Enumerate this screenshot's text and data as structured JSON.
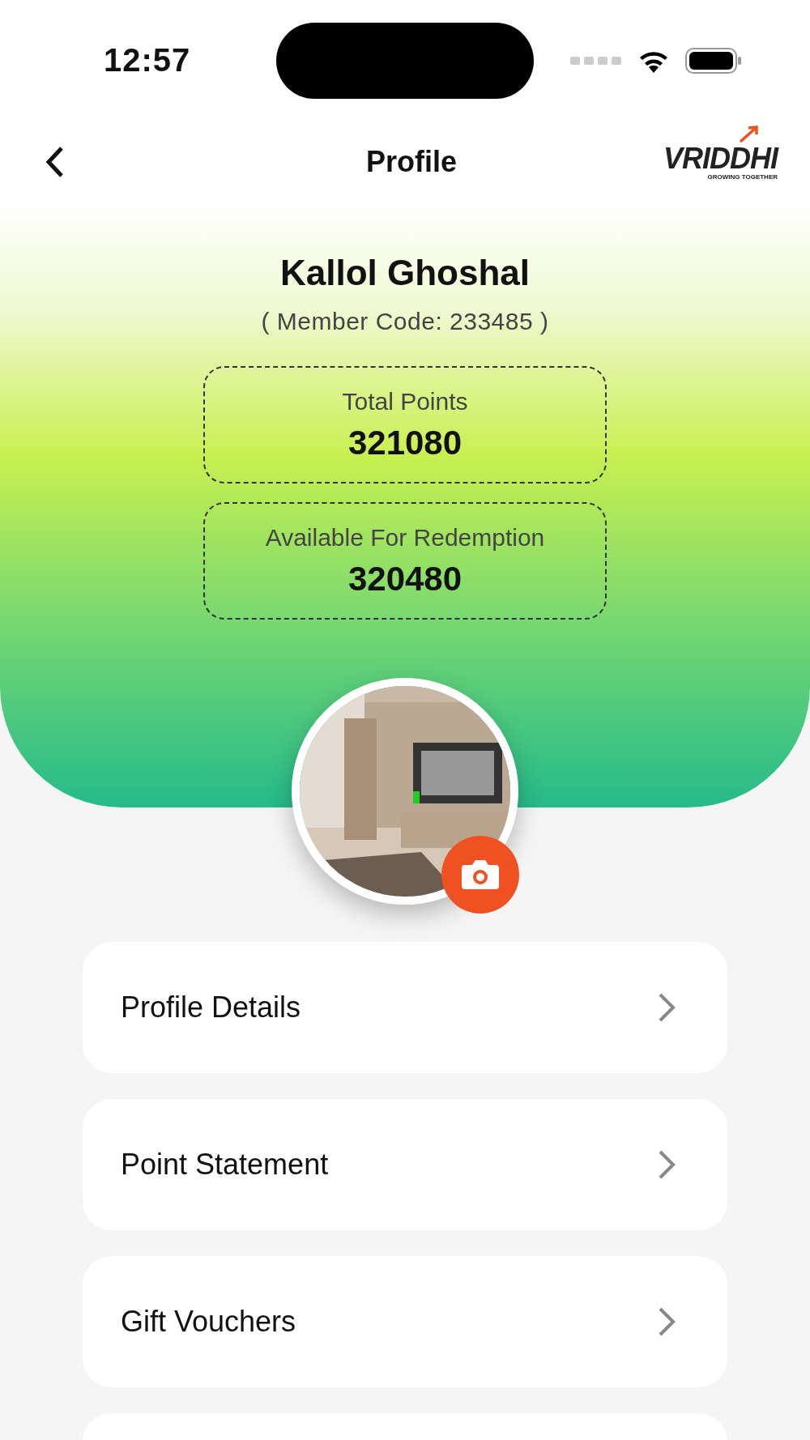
{
  "status_bar": {
    "time": "12:57"
  },
  "header": {
    "title": "Profile",
    "logo": {
      "name": "VRIDDHI",
      "tagline": "GROWING TOGETHER"
    }
  },
  "profile": {
    "name": "Kallol Ghoshal",
    "member_code": "( Member Code: 233485 )"
  },
  "points": [
    {
      "label": "Total Points",
      "value": "321080"
    },
    {
      "label": "Available For Redemption",
      "value": "320480"
    }
  ],
  "menu": [
    {
      "kind": "link",
      "label": "Profile Details"
    },
    {
      "kind": "link",
      "label": "Point Statement"
    },
    {
      "kind": "link",
      "label": "Gift Vouchers"
    },
    {
      "kind": "cut_off"
    }
  ]
}
